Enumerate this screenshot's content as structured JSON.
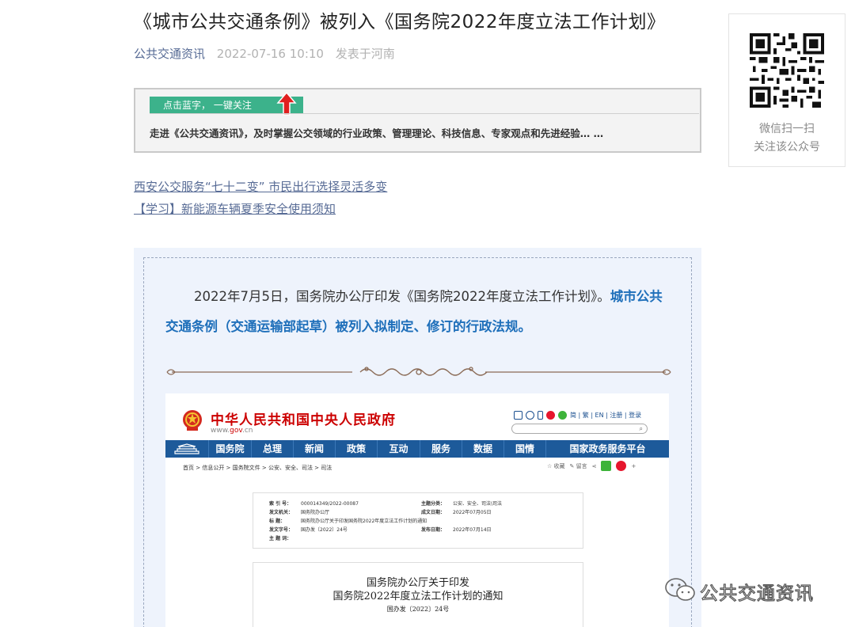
{
  "article": {
    "title": "《城市公共交通条例》被列入《国务院2022年度立法工作计划》",
    "account": "公共交通资讯",
    "datetime": "2022-07-16 10:10",
    "location": "发表于河南"
  },
  "qr_panel": {
    "line1": "微信扫一扫",
    "line2": "关注该公众号"
  },
  "banner": {
    "tag": "点击蓝字， 一键关注",
    "text": "走进《公共交通资讯》，及时掌握公交领域的行业政策、管理理论、科技信息、专家观点和先进经验… …"
  },
  "related_links": [
    "西安公交服务“七十二变” 市民出行选择灵活多变",
    "【学习】新能源车辆夏季安全使用须知"
  ],
  "body": {
    "para_plain": "2022年7月5日，国务院办公厅印发《国务院2022年度立法工作计划》。",
    "para_highlight": "城市公共交通条例（交通运输部起草）被列入拟制定、修订的行政法规。"
  },
  "gov_screenshot": {
    "site_title": "中华人民共和国中央人民政府",
    "site_url_prefix": "www.",
    "site_url_red": "gov",
    "site_url_suffix": ".cn",
    "top_links": "简 | 繁 | EN | 注册 | 登录",
    "nav": [
      "国务院",
      "总理",
      "新闻",
      "政策",
      "互动",
      "服务",
      "数据",
      "国情",
      "国家政务服务平台"
    ],
    "breadcrumb": "首页 > 信息公开 > 国务院文件 > 公安、安全、司法 > 司法",
    "tools": [
      "☆ 收藏",
      "✎ 留言"
    ],
    "info": {
      "suoyin_label": "索 引 号：",
      "suoyin_value": "000014349/2022-00087",
      "zhuti_label": "主题分类：",
      "zhuti_value": "公安、安全、司法\\司法",
      "fawen_label": "发文机关：",
      "fawen_value": "国务院办公厅",
      "chengwen_label": "成文日期：",
      "chengwen_value": "2022年07月05日",
      "biaoti_label": "标 题：",
      "biaoti_value": "国务院办公厅关于印发国务院2022年度立法工作计划的通知",
      "zihao_label": "发文字号：",
      "zihao_value": "国办发〔2022〕24号",
      "fabu_label": "发布日期：",
      "fabu_value": "2022年07月14日",
      "zhutici_label": "主 题 词："
    },
    "doc_title_1": "国务院办公厅关于印发",
    "doc_title_2": "国务院2022年度立法工作计划的通知",
    "doc_number": "国办发〔2022〕24号"
  },
  "watermark": "公共交通资讯",
  "colors": {
    "link": "#576b95",
    "highlight": "#1e6fba",
    "banner_tag": "#3cb28b",
    "gov_nav": "#1d5a9a",
    "gov_red": "#cc0000"
  }
}
